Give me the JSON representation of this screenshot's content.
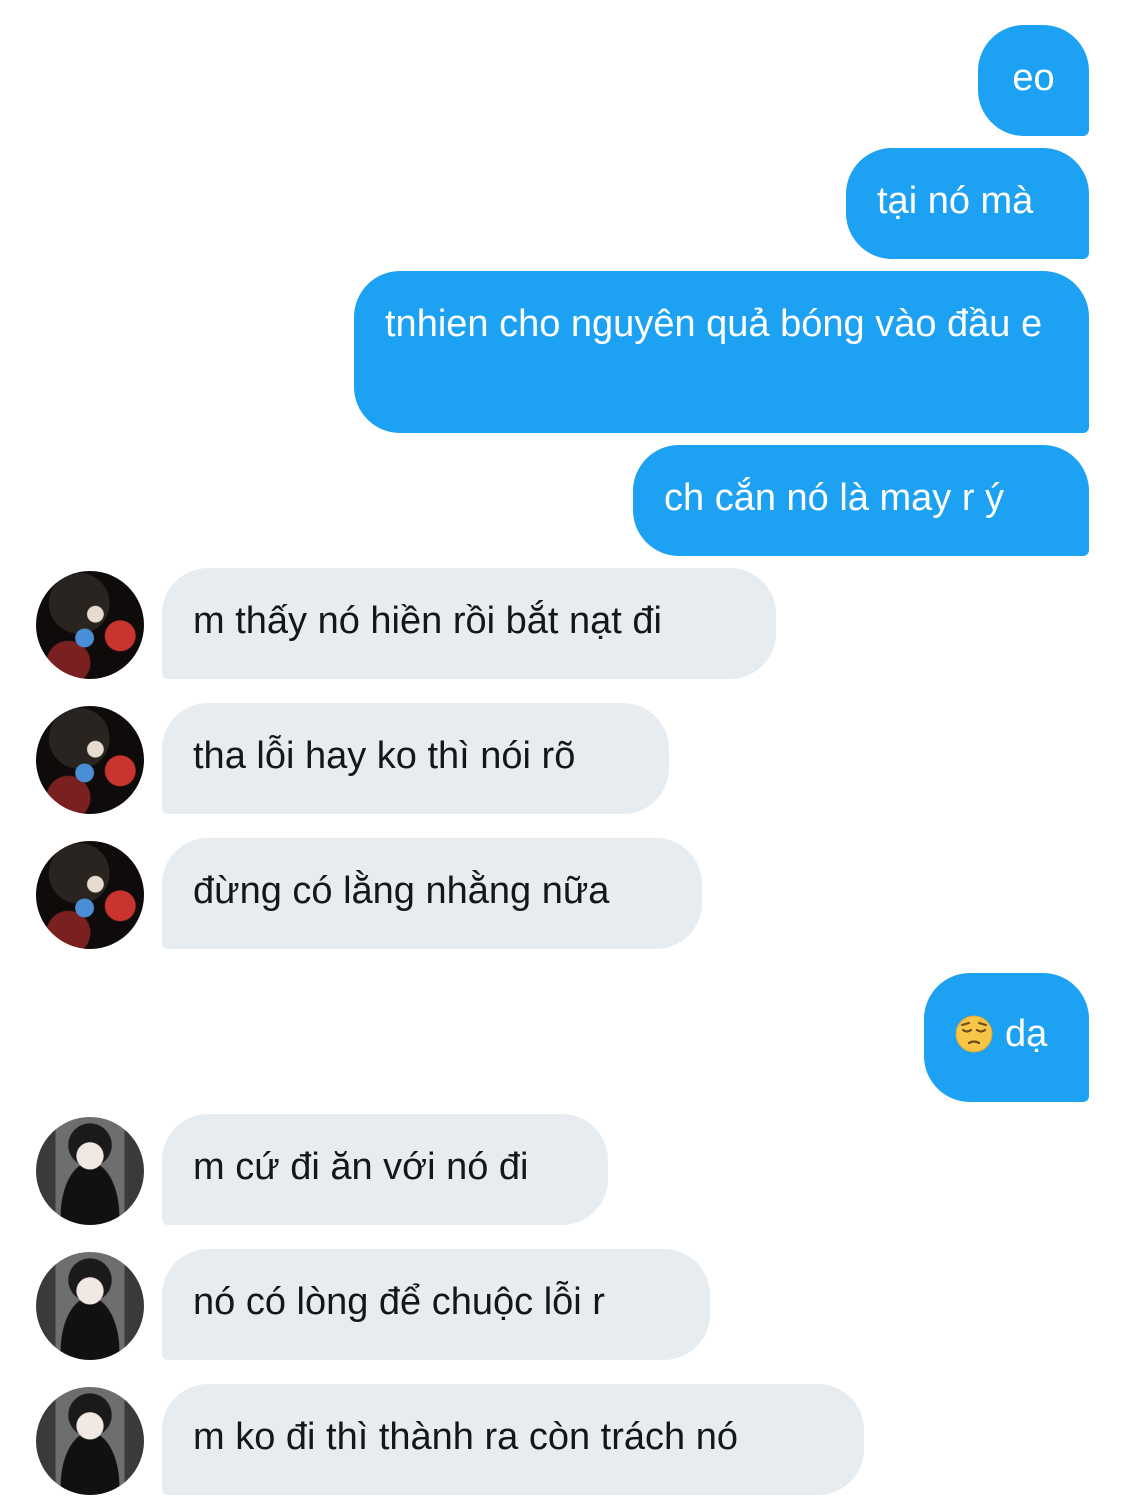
{
  "messages": [
    {
      "side": "sent",
      "text": "eo"
    },
    {
      "side": "sent",
      "text": "tại nó mà"
    },
    {
      "side": "sent",
      "text": "tnhien cho nguyên quả bóng vào đầu e"
    },
    {
      "side": "sent",
      "text": "ch cắn nó là may r ý"
    },
    {
      "side": "received",
      "avatar": "avatar-a",
      "text": "m thấy nó hiền rồi bắt nạt đi"
    },
    {
      "side": "received",
      "avatar": "avatar-a",
      "text": "tha lỗi hay ko thì nói rõ"
    },
    {
      "side": "received",
      "avatar": "avatar-a",
      "text": "đừng có lằng nhằng nữa"
    },
    {
      "side": "sent",
      "emoji": "pensive-face-emoji",
      "text": "dạ"
    },
    {
      "side": "received",
      "avatar": "avatar-b",
      "text": "m cứ đi ăn với nó đi"
    },
    {
      "side": "received",
      "avatar": "avatar-b",
      "text": "nó có lòng để chuộc lỗi r"
    },
    {
      "side": "received",
      "avatar": "avatar-b",
      "text": "m ko đi thì thành ra còn trách nó"
    }
  ],
  "colors": {
    "sent_bubble": "#1da1f2",
    "received_bubble": "#e6ecf0",
    "sent_text": "#ffffff",
    "received_text": "#14171a"
  }
}
